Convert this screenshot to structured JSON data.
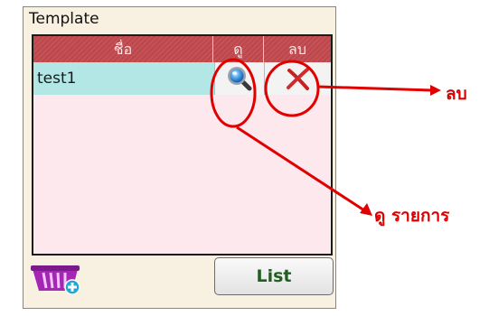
{
  "panel": {
    "title": "Template",
    "table": {
      "columns": [
        "ชื่อ",
        "ดู",
        "ลบ"
      ],
      "rows": [
        {
          "name": "test1",
          "view_icon": "magnifier-icon",
          "delete_icon": "delete-x-icon"
        }
      ]
    },
    "add_icon": "basket-add-icon",
    "list_button": "List"
  },
  "callouts": {
    "delete_label": "ลบ",
    "view_label": "ดู รายการ",
    "color": "#dd0000"
  }
}
